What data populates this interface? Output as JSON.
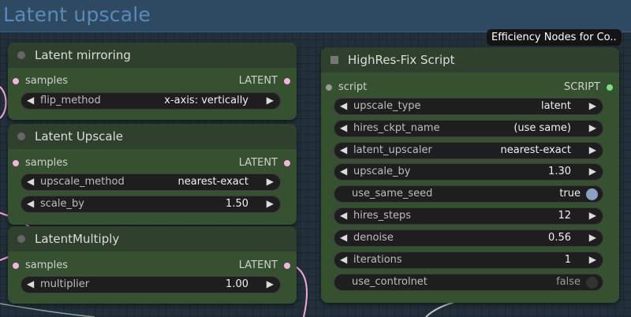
{
  "group": {
    "title": "Latent upscale"
  },
  "tooltip": {
    "text": "Efficiency Nodes for Co.."
  },
  "colors": {
    "node_body": "#35512f",
    "node_header": "#2f402d",
    "latent_socket": "#f7b2e4",
    "script_socket": "#7fe07f",
    "group_title": "#5b8ab6"
  },
  "nodes": {
    "latent_mirroring": {
      "title": "Latent mirroring",
      "input_label": "samples",
      "output_label": "LATENT",
      "flip_method": {
        "label": "flip_method",
        "value": "x-axis: vertically"
      }
    },
    "latent_upscale": {
      "title": "Latent Upscale",
      "input_label": "samples",
      "output_label": "LATENT",
      "upscale_method": {
        "label": "upscale_method",
        "value": "nearest-exact"
      },
      "scale_by": {
        "label": "scale_by",
        "value": "1.50"
      }
    },
    "latent_multiply": {
      "title": "LatentMultiply",
      "input_label": "samples",
      "output_label": "LATENT",
      "multiplier": {
        "label": "multiplier",
        "value": "1.00"
      }
    },
    "hires_fix": {
      "title": "HighRes-Fix Script",
      "input_label": "script",
      "output_label": "SCRIPT",
      "upscale_type": {
        "label": "upscale_type",
        "value": "latent"
      },
      "hires_ckpt_name": {
        "label": "hires_ckpt_name",
        "value": "(use same)"
      },
      "latent_upscaler": {
        "label": "latent_upscaler",
        "value": "nearest-exact"
      },
      "upscale_by": {
        "label": "upscale_by",
        "value": "1.30"
      },
      "use_same_seed": {
        "label": "use_same_seed",
        "value": "true"
      },
      "hires_steps": {
        "label": "hires_steps",
        "value": "12"
      },
      "denoise": {
        "label": "denoise",
        "value": "0.56"
      },
      "iterations": {
        "label": "iterations",
        "value": "1"
      },
      "use_controlnet": {
        "label": "use_controlnet",
        "value": "false"
      }
    }
  }
}
